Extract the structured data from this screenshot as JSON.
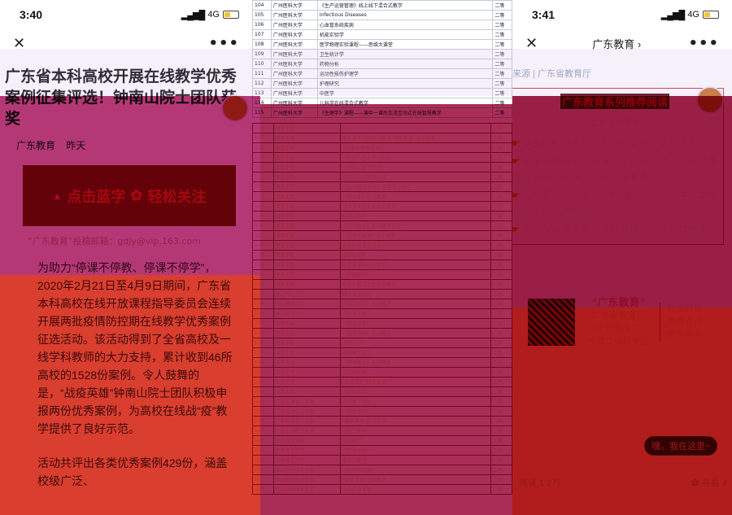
{
  "left": {
    "status": {
      "time": "3:40",
      "network": "4G"
    },
    "navbar": {
      "close": "✕",
      "more": "•••"
    },
    "title": "广东省本科高校开展在线教学优秀案例征集评选！钟南山院士团队获奖",
    "meta": {
      "account": "广东教育",
      "date": "昨天"
    },
    "banner": {
      "text": "点击蓝字",
      "text2": "轻松关注"
    },
    "url_line": "“广东教育”投稿邮箱：gdjy@vip.163.com",
    "para1": "为助力“停课不停教、停课不停学”，2020年2月21日至4月9日期间，广东省本科高校在线开放课程指导委员会连续开展两批疫情防控期在线教学优秀案例征选活动。该活动得到了全省高校及一线学科教师的大力支持，累计收到46所高校的1528份案例。令人鼓舞的是，“战疫英雄”钟南山院士团队积极申报两份优秀案例，为高校在线战“疫”教学提供了良好示范。",
    "para2": "活动共评出各类优秀案例429份，涵盖校级广泛、"
  },
  "mid": {
    "rows_top": [
      [
        "104",
        "广州医科大学",
        "《生产运营管理》线上线下混合式教学",
        "二等"
      ],
      [
        "105",
        "广州医科大学",
        "Infectious Diseases",
        "二等"
      ],
      [
        "106",
        "广州医科大学",
        "心血管系统疾病",
        "二等"
      ],
      [
        "107",
        "广州医科大学",
        "机能实验学",
        "二等"
      ],
      [
        "108",
        "广州医科大学",
        "医学物理实验课程——思维大课堂",
        "二等"
      ],
      [
        "109",
        "广州医科大学",
        "卫生统计学",
        "二等"
      ],
      [
        "110",
        "广州医科大学",
        "药物分析",
        "二等"
      ],
      [
        "111",
        "广州医科大学",
        "运动性损伤护理学",
        "二等"
      ],
      [
        "112",
        "广州医科大学",
        "护理研究",
        "二等"
      ],
      [
        "113",
        "广州医科大学",
        "中医学",
        "二等"
      ],
      [
        "114",
        "广州医科大学",
        "儿科学在线混合式教学",
        "二等"
      ],
      [
        "115",
        "广州医科大学",
        "《生理学》课程——课中一课后交流互动式在线智慧教学",
        "二等"
      ]
    ],
    "rows_bottom": [
      [
        "116",
        "韶关学院",
        "……",
        "二等"
      ],
      [
        "117",
        "韶关学院",
        "基于多平台的线上线下“两步教学”混合教学",
        "二等"
      ],
      [
        "118",
        "嘉应学院",
        "《C语言程序设计》",
        "二等"
      ],
      [
        "119",
        "嘉应学院",
        "《中国古代文学（1）》",
        "二等"
      ],
      [
        "120",
        "嘉应学院",
        "《学前儿童卫生学》",
        "二等"
      ],
      [
        "121",
        "嘉应学院",
        "在线混合式教学实践",
        "二等"
      ],
      [
        "122",
        "肇庆学院",
        "《Java程序设计》课程线上教学",
        "二等"
      ],
      [
        "123",
        "肇庆学院",
        "《统计学》在线教学",
        "二等"
      ],
      [
        "124",
        "肇庆学院",
        "《大学英语》混合式教学",
        "二等"
      ],
      [
        "125",
        "肇庆学院",
        "标签式教学",
        "二等"
      ],
      [
        "126",
        "肇庆学院",
        "《文学概论》在线教学设计",
        "二等"
      ],
      [
        "127",
        "肇庆学院",
        "《管理学原理》线上教学",
        "二等"
      ],
      [
        "128",
        "肇庆学院",
        "在线开放课程建设",
        "二等"
      ],
      [
        "129",
        "肇庆学院",
        "数字化教学",
        "二等"
      ],
      [
        "130",
        "肇庆学院",
        "外语类课程在线教学",
        "二等"
      ],
      [
        "131",
        "肇庆学院",
        "《数据结构》",
        "二等"
      ],
      [
        "132",
        "肇庆学院",
        "化学工程与工艺在线教学",
        "二等"
      ],
      [
        "133",
        "韩山师范学院",
        "线上课程运行",
        "二等"
      ],
      [
        "134",
        "韩山师范学院",
        "《电工技术》在线教学",
        "二等"
      ],
      [
        "135",
        "韩山师范学院",
        "《化学工艺》",
        "二等"
      ],
      [
        "136",
        "惠州学院",
        "《英语语音》",
        "二等"
      ],
      [
        "137",
        "惠州学院",
        "《数学分析》在线教学",
        "二等"
      ],
      [
        "138",
        "惠州学院",
        "《会计学》",
        "二等"
      ],
      [
        "139",
        "五邑大学",
        "在线教学设计",
        "二等"
      ],
      [
        "140",
        "五邑大学",
        "《高等数学》在线教学",
        "二等"
      ],
      [
        "141",
        "五邑大学",
        "《工程制图》",
        "二等"
      ],
      [
        "142",
        "五邑大学",
        "“在线课程”线上教学",
        "二等"
      ],
      [
        "143",
        "五邑大学",
        "《材料力学》",
        "二等"
      ],
      [
        "144",
        "广东石油化工学院",
        "在线教学组织",
        "二等"
      ],
      [
        "145",
        "广东石油化工学院",
        "《有机化学》",
        "二等"
      ],
      [
        "146",
        "广东石油化工学院",
        "“翻转课堂”在线教学",
        "二等"
      ],
      [
        "147",
        "广东石油化工学院",
        "《化工原理》",
        "二等"
      ],
      [
        "148",
        "东莞理工学院",
        "在线教学",
        "二等"
      ],
      [
        "149",
        "东莞理工学院",
        "《电路分析》",
        "二等"
      ],
      [
        "150",
        "东莞理工学院",
        "混合式教学",
        "二等"
      ],
      [
        "151",
        "佛山科学技术学院",
        "《计算机网络》",
        "二等"
      ],
      [
        "152",
        "佛山科学技术学院",
        "“智慧课堂”在线教学",
        "二等"
      ],
      [
        "153",
        "佛山科学技术学院",
        "在线开放课程",
        "二等"
      ]
    ]
  },
  "right": {
    "status": {
      "time": "3:41",
      "network": "4G"
    },
    "navbar": {
      "close": "✕",
      "title": "广东教育 ›",
      "more": "•••"
    },
    "source": "来源 | 广东省教育厅",
    "box_title": "广东教育系列推荐阅读",
    "box_sub": "（上下滑动查看）",
    "items": [
      "学生们即将返校，老师们要做好这些准备！",
      "帮学生晒被子、按身高设置洗手池……各地各校推出暖心举措，为返校做准备",
      "云揽笔、云统考、云教研……广东大中小学推出了这些“云”措施",
      "如何保证孩子安全返校复课？广东这样做了！"
    ],
    "qr_brand": "“广东教育”",
    "qr_lines": [
      "广东省教育厅",
      "政务微信 中",
      "长按二维码关注"
    ],
    "qr_side": [
      "政策解读",
      "教育资讯",
      "服务平台"
    ],
    "follow": "嘿，我在这里~",
    "reads": "阅读 1.2万",
    "likes": "在看 4"
  }
}
